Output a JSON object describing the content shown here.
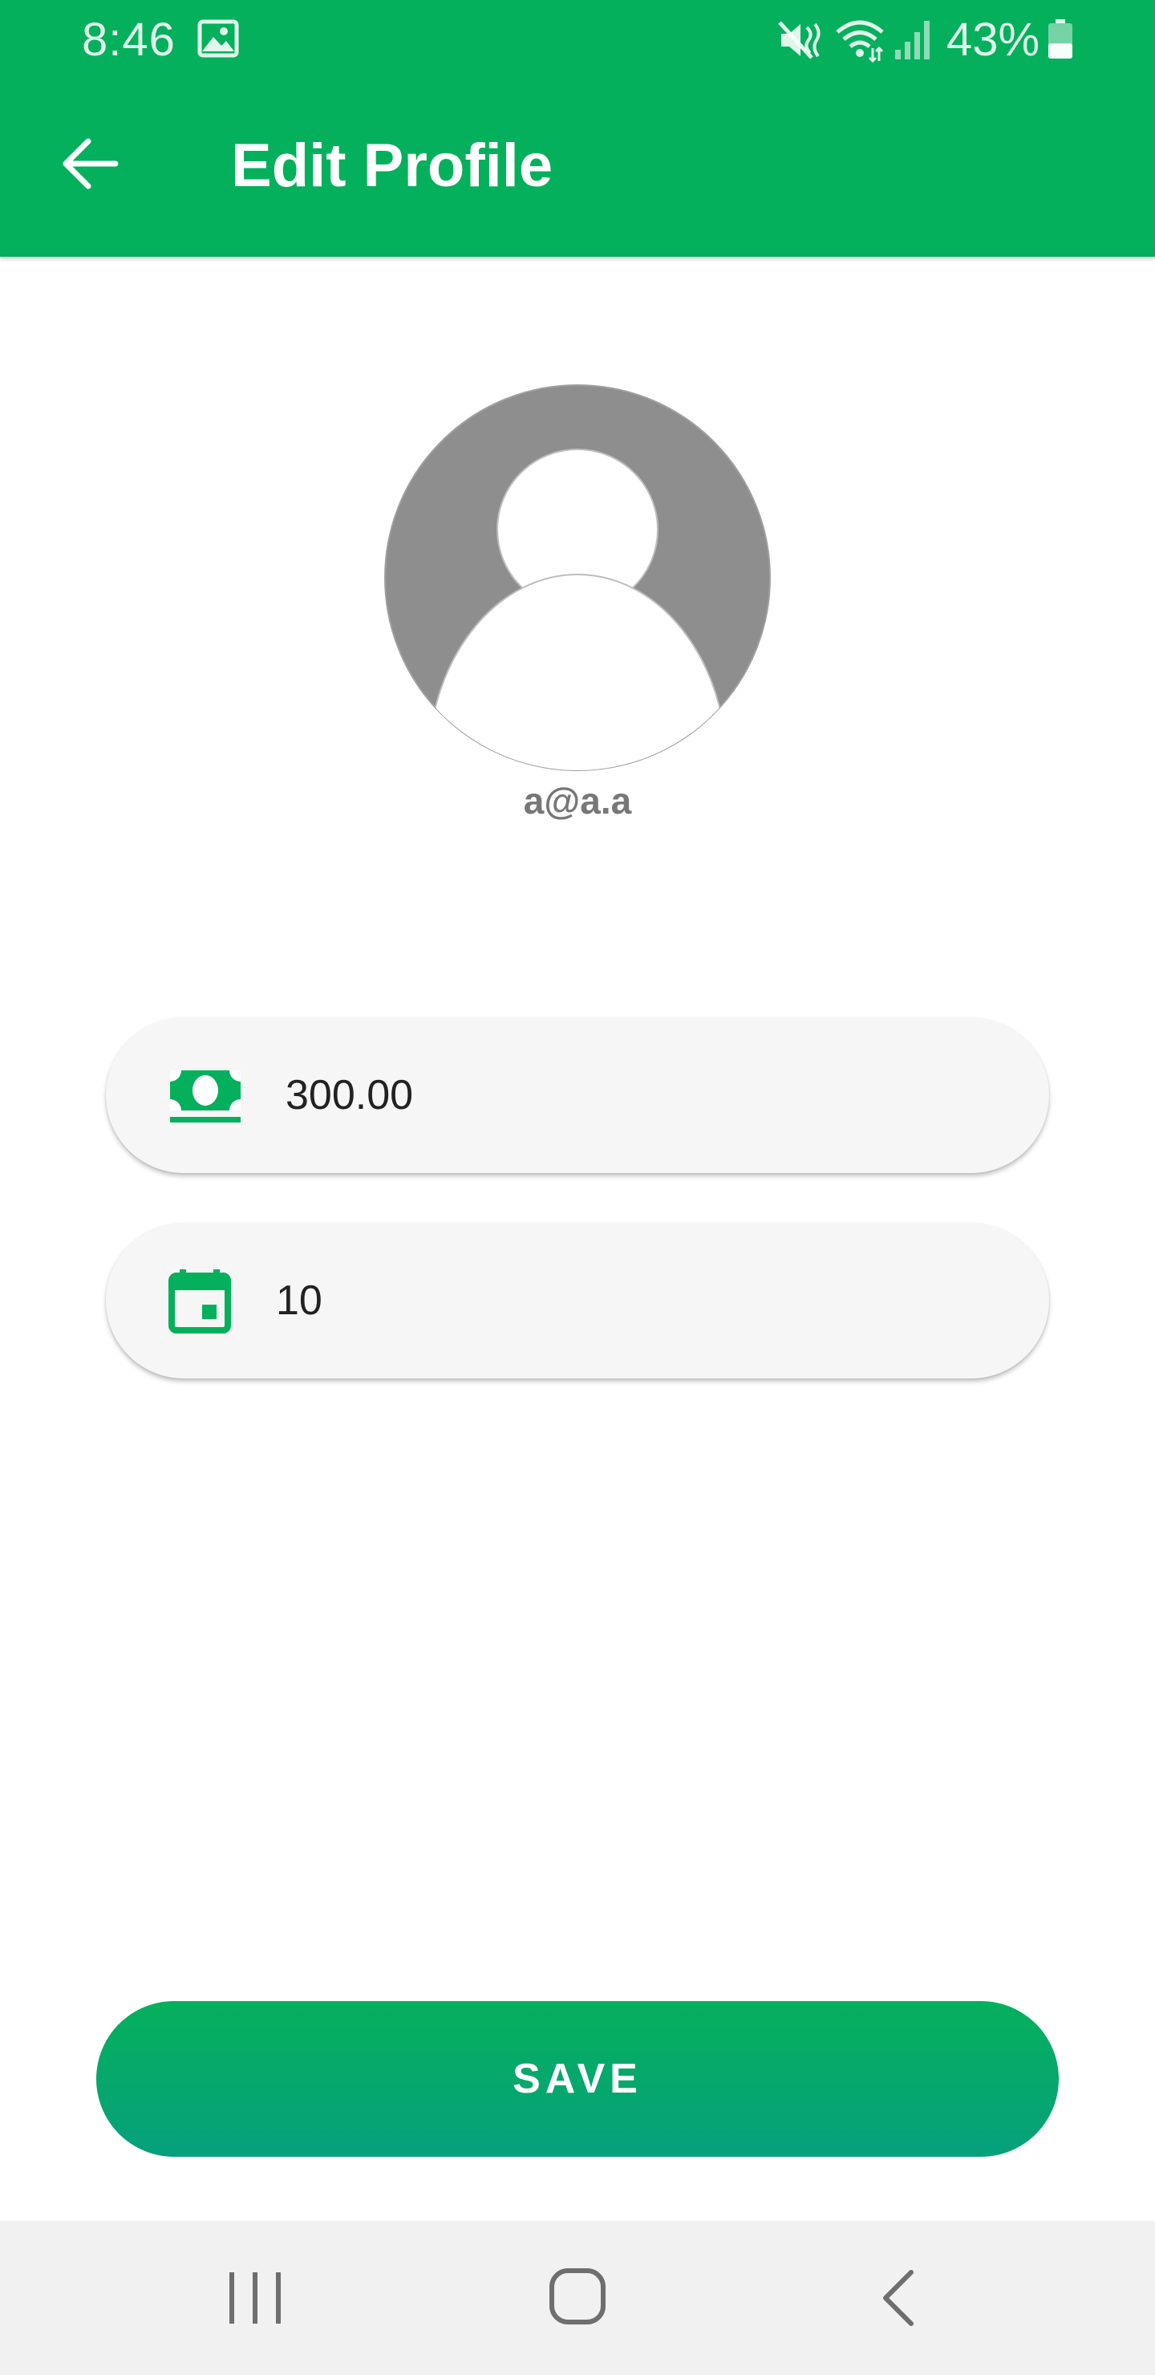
{
  "status_bar": {
    "time": "8:46",
    "battery_percent": "43%",
    "battery_level": 0.43
  },
  "app_bar": {
    "title": "Edit Profile",
    "back_icon": "arrow-back-icon"
  },
  "profile": {
    "avatar_icon": "default-user-avatar",
    "email": "a@a.a"
  },
  "form": {
    "amount": {
      "icon": "cash-icon",
      "value": "300.00"
    },
    "days": {
      "icon": "calendar-icon",
      "value": "10"
    }
  },
  "actions": {
    "save_label": "SAVE"
  },
  "navigation": {
    "recents_icon": "recents-icon",
    "home_icon": "home-icon",
    "back_icon": "back-chevron-icon"
  },
  "colors": {
    "primary": "#05b05c",
    "primary_dark": "#06a07c",
    "field_background": "#f6f6f6",
    "avatar_gray": "#8e8e8e"
  }
}
